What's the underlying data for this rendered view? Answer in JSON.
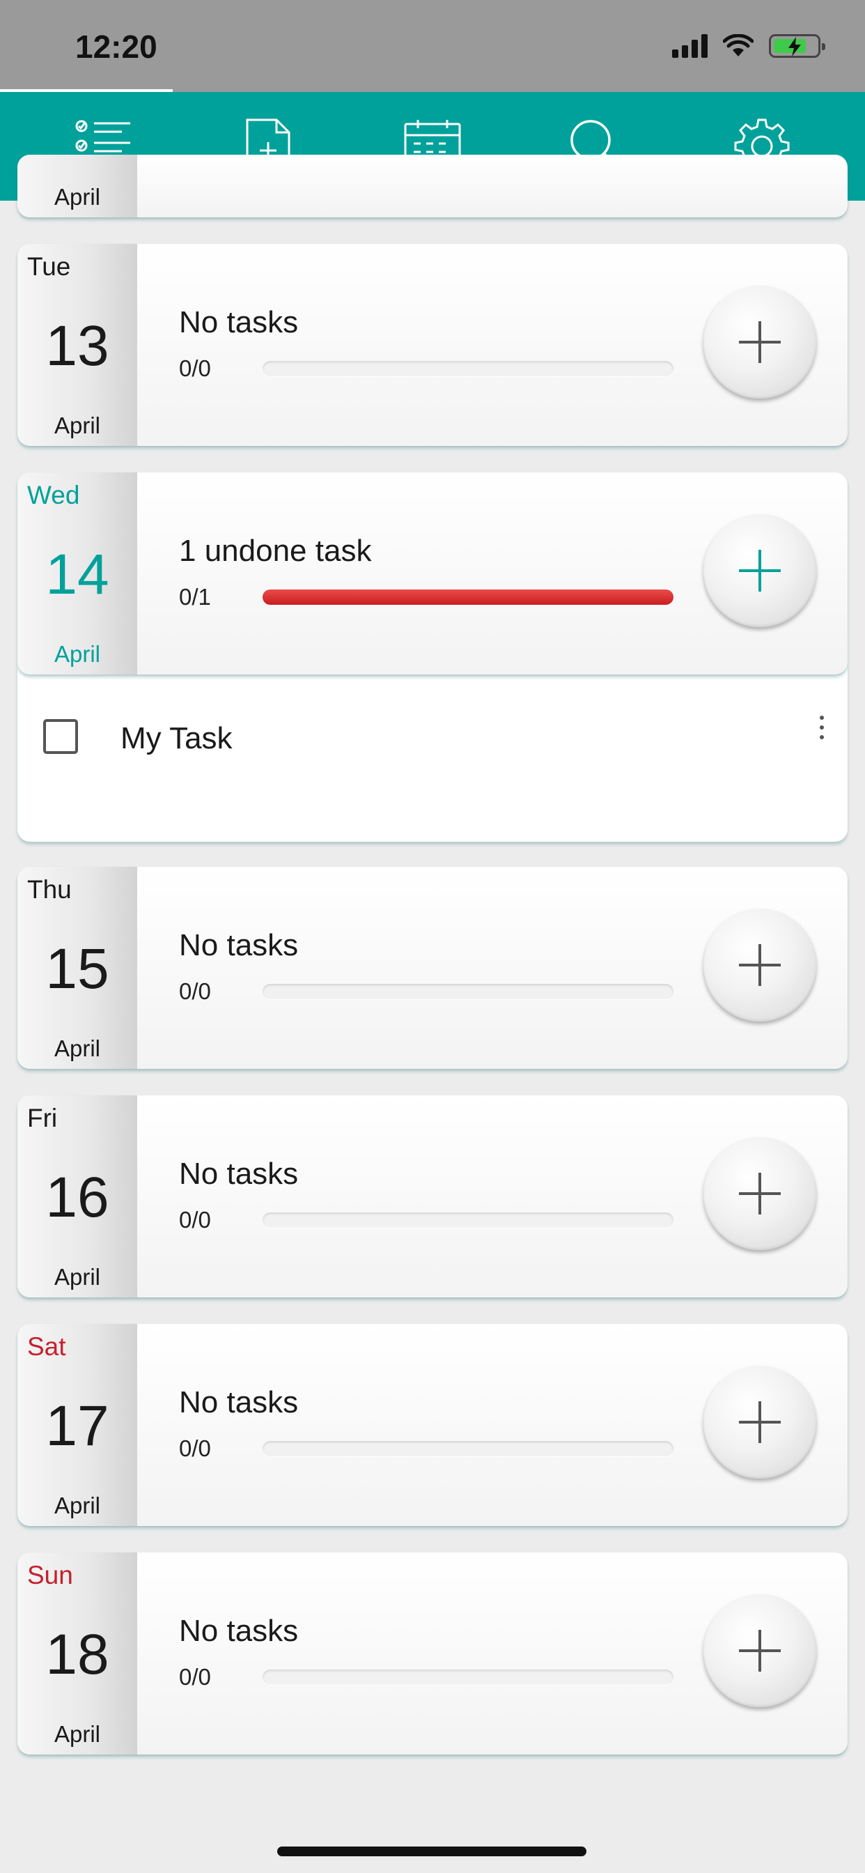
{
  "status_bar": {
    "time": "12:20"
  },
  "toolbar": {
    "buttons": [
      {
        "icon": "task-list-icon"
      },
      {
        "icon": "new-document-icon"
      },
      {
        "icon": "calendar-icon"
      },
      {
        "icon": "search-icon"
      },
      {
        "icon": "settings-gear-icon"
      }
    ]
  },
  "colors": {
    "accent": "#00a19a",
    "weekend": "#c6202c",
    "progress_undone": "#d62b2b"
  },
  "previous_day": {
    "month": "April"
  },
  "days": [
    {
      "weekday": "Tue",
      "day": "13",
      "month": "April",
      "summary": "No tasks",
      "count": "0/0",
      "progress": 0
    },
    {
      "weekday": "Wed",
      "day": "14",
      "month": "April",
      "summary": "1 undone task",
      "count": "0/1",
      "progress": 1,
      "selected": true
    },
    {
      "weekday": "Thu",
      "day": "15",
      "month": "April",
      "summary": "No tasks",
      "count": "0/0",
      "progress": 0
    },
    {
      "weekday": "Fri",
      "day": "16",
      "month": "April",
      "summary": "No tasks",
      "count": "0/0",
      "progress": 0
    },
    {
      "weekday": "Sat",
      "day": "17",
      "month": "April",
      "summary": "No tasks",
      "count": "0/0",
      "progress": 0
    },
    {
      "weekday": "Sun",
      "day": "18",
      "month": "April",
      "summary": "No tasks",
      "count": "0/0",
      "progress": 0
    }
  ],
  "expanded_tasks": [
    {
      "label": "My Task",
      "done": false
    }
  ]
}
